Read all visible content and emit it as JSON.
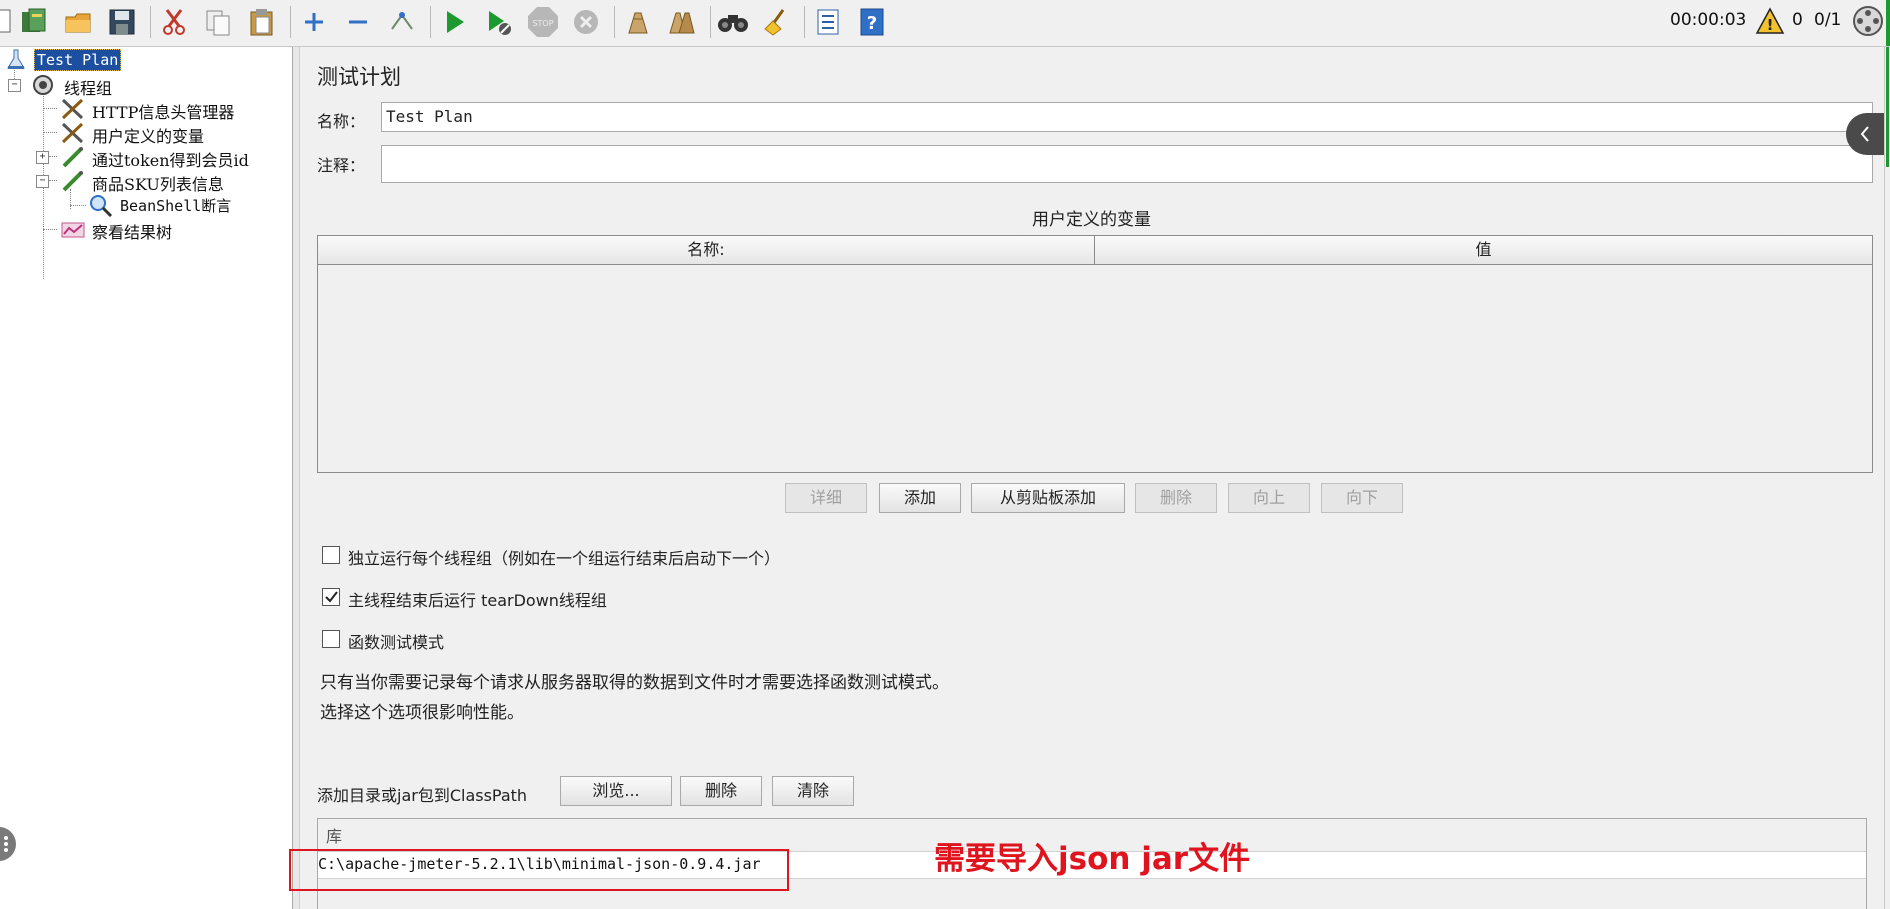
{
  "status": {
    "elapsed": "00:00:03",
    "warnings": "0",
    "threads": "0/1"
  },
  "toolbar": {
    "icons": [
      "new-icon",
      "templates-icon",
      "open-icon",
      "save-icon",
      "cut-icon",
      "copy-icon",
      "paste-icon",
      "expand-icon",
      "collapse-icon",
      "toggle-icon",
      "start-icon",
      "start-no-pauses-icon",
      "stop-icon",
      "shutdown-icon",
      "clear-icon",
      "clear-all-icon",
      "search-icon",
      "reset-search-icon",
      "function-helper-icon",
      "help-icon"
    ]
  },
  "tree": {
    "items": [
      {
        "label": "Test Plan",
        "selected": true,
        "icon": "test-plan-icon"
      },
      {
        "label": "线程组",
        "icon": "thread-group-icon"
      },
      {
        "label": "HTTP信息头管理器",
        "icon": "config-element-icon"
      },
      {
        "label": "用户定义的变量",
        "icon": "config-element-icon"
      },
      {
        "label": "通过token得到会员id",
        "icon": "sampler-icon"
      },
      {
        "label": "商品SKU列表信息",
        "icon": "sampler-icon"
      },
      {
        "label": "BeanShell断言",
        "icon": "assertion-icon"
      },
      {
        "label": "察看结果树",
        "icon": "listener-icon"
      }
    ]
  },
  "main": {
    "title": "测试计划",
    "name_label": "名称：",
    "name_value": "Test Plan",
    "comment_label": "注释：",
    "comment_value": "",
    "vars_title": "用户定义的变量",
    "vars_columns": [
      "名称:",
      "值"
    ],
    "vars_rows": [],
    "buttons": [
      {
        "label": "详细",
        "enabled": false
      },
      {
        "label": "添加",
        "enabled": true
      },
      {
        "label": "从剪贴板添加",
        "enabled": true
      },
      {
        "label": "删除",
        "enabled": false
      },
      {
        "label": "向上",
        "enabled": false
      },
      {
        "label": "向下",
        "enabled": false
      }
    ],
    "checkboxes": [
      {
        "label": "独立运行每个线程组（例如在一个组运行结束后启动下一个）",
        "checked": false
      },
      {
        "label": "主线程结束后运行 tearDown线程组",
        "checked": true
      },
      {
        "label": "函数测试模式",
        "checked": false
      }
    ],
    "hint_line1": "只有当你需要记录每个请求从服务器取得的数据到文件时才需要选择函数测试模式。",
    "hint_line2": "选择这个选项很影响性能。",
    "classpath_label": "添加目录或jar包到ClassPath",
    "classpath_buttons": [
      "浏览...",
      "删除",
      "清除"
    ],
    "lib_header": "库",
    "lib_rows": [
      "C:\\apache-jmeter-5.2.1\\lib\\minimal-json-0.9.4.jar"
    ]
  },
  "annotation": {
    "text": "需要导入json jar文件",
    "color": "#e0141e"
  }
}
